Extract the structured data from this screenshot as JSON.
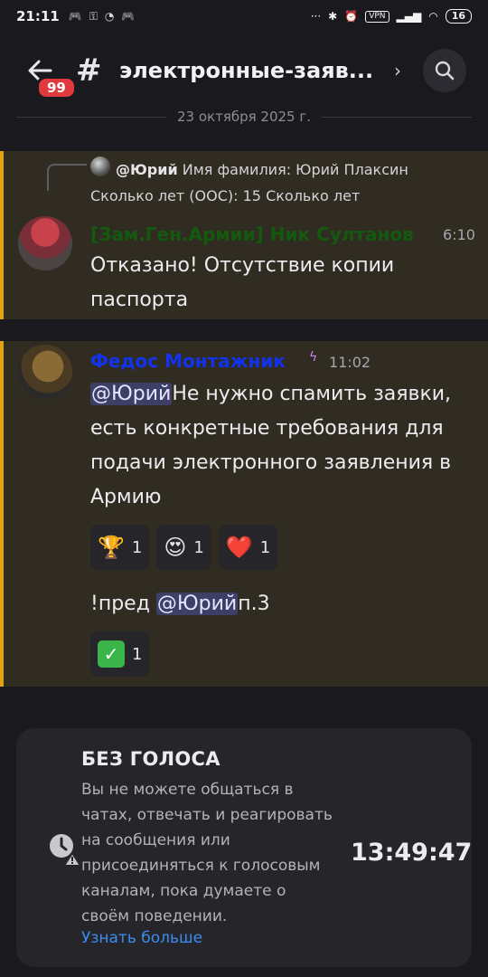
{
  "status_bar": {
    "time": "21:11",
    "vpn": "VPN",
    "battery": "16",
    "overflow": "···"
  },
  "header": {
    "unread_count": "99",
    "channel_name": "электронные-заяв...",
    "chevron": "›"
  },
  "date_divider": "23 октября 2025 г.",
  "messages": [
    {
      "reply": {
        "author": "@Юрий",
        "text": "Имя фамилия: Юрий Плаксин Сколько лет (ООС): 15 Сколько лет"
      },
      "author": "[Зам.Ген.Армии] Ник Султанов",
      "author_color": "#135a0f",
      "time": "6:10",
      "text": "Отказано! Отсутствие копии паспорта"
    },
    {
      "author": "Федос Монтажник",
      "author_color": "#1133ee",
      "time": "11:02",
      "mention": "@Юрий",
      "text": "Не нужно спамить заявки, есть конкретные требования для подачи электронного заявления в Армию",
      "reactions": [
        {
          "emoji": "🏆",
          "icon": "trophy-icon",
          "count": "1"
        },
        {
          "emoji": "😍",
          "icon": "heart-eyes-icon",
          "count": "1"
        },
        {
          "emoji": "❤️",
          "icon": "heart-icon",
          "count": "1"
        }
      ],
      "followup": {
        "prefix": "!пред ",
        "mention": "@Юрий",
        "suffix": "п.3"
      },
      "followup_reactions": [
        {
          "emoji": "✓",
          "icon": "check-mark-icon",
          "count": "1"
        }
      ]
    }
  ],
  "timeout": {
    "title": "БЕЗ ГОЛОСА",
    "description": "Вы не можете общаться в чатах, отвечать и реагировать на сообщения или присоединяться к голосовым каналам, пока думаете о своём поведении.",
    "link": "Узнать больше",
    "countdown": "13:49:47"
  },
  "colors": {
    "accent_bar": "#e0a515",
    "link": "#3c8cf0",
    "badge": "#e03a3e"
  }
}
